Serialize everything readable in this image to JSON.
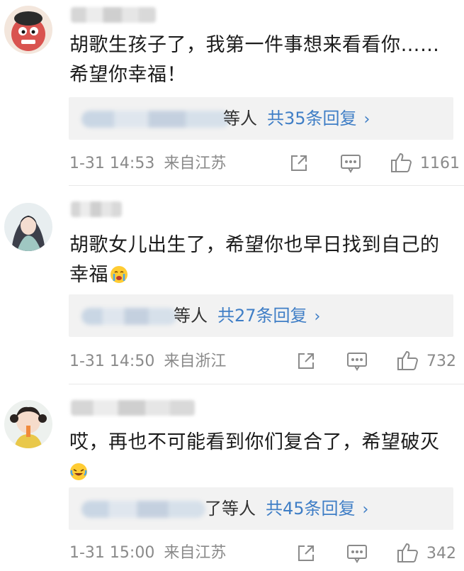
{
  "comments": [
    {
      "text_line1": "胡歌生孩子了，我第一件事想来看看你……",
      "text_line2": "希望你幸福！",
      "reply_tail": "等人",
      "reply_link": "共35条回复",
      "time": "1-31 14:53",
      "source": "来自江苏",
      "likes": "1161"
    },
    {
      "text_line1": "胡歌女儿出生了，希望你也早日找到自己的",
      "text_line2": "幸福",
      "emoji": "crying-face-emoji",
      "reply_tail": "等人",
      "reply_link": "共27条回复",
      "time": "1-31 14:50",
      "source": "来自浙江",
      "likes": "732"
    },
    {
      "text_line1": "哎，再也不可能看到你们复合了，希望破灭",
      "text_line2": "",
      "emoji": "laughing-tears-emoji",
      "reply_tail": "了等人",
      "reply_link": "共45条回复",
      "time": "1-31 15:00",
      "source": "来自江苏",
      "likes": "342"
    }
  ],
  "icons": {
    "share": "share-icon",
    "comment": "comment-icon",
    "like": "thumbs-up-icon",
    "chevron": "›"
  },
  "colors": {
    "link": "#3f7ec6",
    "meta": "#8a8a8a",
    "reply_bg": "#f2f2f2"
  }
}
